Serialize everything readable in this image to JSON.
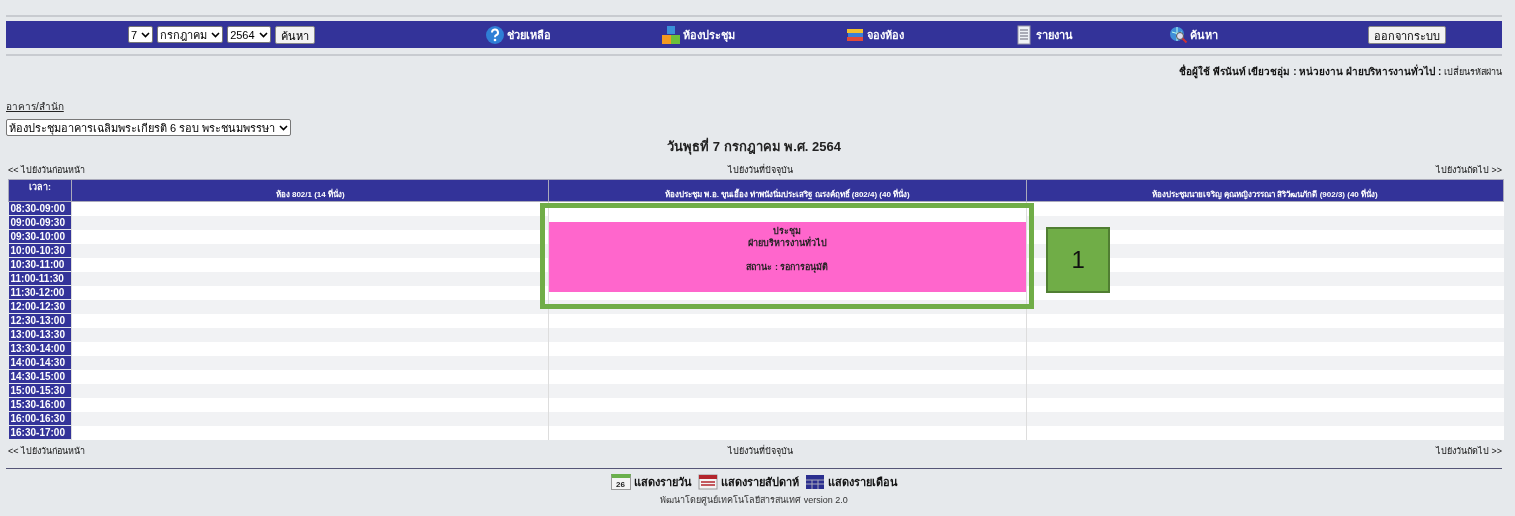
{
  "nav_bar": {
    "day_select": "7",
    "month_select": "กรกฎาคม",
    "year_select": "2564",
    "search_button": "ค้นหา",
    "items": [
      {
        "kind": "help",
        "label": "ช่วยเหลือ"
      },
      {
        "kind": "rooms",
        "label": "ห้องประชุม"
      },
      {
        "kind": "booking",
        "label": "จองห้อง"
      },
      {
        "kind": "report",
        "label": "รายงาน"
      },
      {
        "kind": "search",
        "label": "ค้นหา"
      }
    ],
    "logout_button": "ออกจากระบบ"
  },
  "user_info": {
    "text": "ชื่อผู้ใช้ พีรนันท์ เขียวชอุ่ม : หน่วยงาน ฝ่ายบริหารงานทั่วไป :",
    "link": "เปลี่ยนรหัสผ่าน"
  },
  "building": {
    "label": "อาคาร/สำนัก",
    "select": "ห้องประชุมอาคารเฉลิมพระเกียรติ 6 รอบ พระชนมพรรษา"
  },
  "date_title": "วันพุธที่ 7 กรกฎาคม พ.ศ. 2564",
  "top_links": {
    "previous": "<< ไปยังวันก่อนหน้า",
    "today": "ไปยังวันที่ปัจจุบัน",
    "next": "ไปยังวันถัดไป >>"
  },
  "schedule": {
    "time_heading": "เวลา:",
    "rooms": [
      "ห้อง 802/1 (14 ที่นั่ง)",
      "ห้องประชุม พ.อ. ขุนเอื้อง ท่าพนังนิ่มประเสริฐ ณรงค์ฤทธิ์ (802/4) (40 ที่นั่ง)",
      "ห้องประชุมนายเจริญ คุณหญิงวรรณา สิริวัฒนภักดี (902/3) (40 ที่นั่ง)"
    ],
    "rows": [
      {
        "time": "08:30-09:00",
        "cells": [
          {
            "kind": "free"
          },
          {
            "kind": "free"
          },
          {
            "kind": "free"
          }
        ]
      },
      {
        "time": "09:00-09:30",
        "cells": [
          {
            "kind": "free"
          },
          {
            "kind": "booking",
            "color": "#ff66cc",
            "title": "ประชุม",
            "unit": "ฝ่ายบริหารงานทั่วไป",
            "status": "สถานะ : รอการอนุมัติ"
          },
          {
            "kind": "free"
          }
        ]
      },
      {
        "time": "09:30-10:00",
        "cells": [
          {
            "kind": "free"
          },
          {
            "kind": "continued"
          },
          {
            "kind": "free"
          }
        ]
      },
      {
        "time": "10:00-10:30",
        "cells": [
          {
            "kind": "free"
          },
          {
            "kind": "continued"
          },
          {
            "kind": "free"
          }
        ]
      },
      {
        "time": "10:30-11:00",
        "cells": [
          {
            "kind": "free"
          },
          {
            "kind": "continued"
          },
          {
            "kind": "free"
          }
        ]
      },
      {
        "time": "11:00-11:30",
        "cells": [
          {
            "kind": "free"
          },
          {
            "kind": "continued"
          },
          {
            "kind": "free"
          }
        ]
      },
      {
        "time": "11:30-12:00",
        "cells": [
          {
            "kind": "free"
          },
          {
            "kind": "continued"
          },
          {
            "kind": "free"
          }
        ]
      },
      {
        "time": "12:00-12:30",
        "cells": [
          {
            "kind": "free"
          },
          {
            "kind": "free"
          },
          {
            "kind": "free"
          }
        ]
      },
      {
        "time": "12:30-13:00",
        "cells": [
          {
            "kind": "free"
          },
          {
            "kind": "free"
          },
          {
            "kind": "free"
          }
        ]
      },
      {
        "time": "13:00-13:30",
        "cells": [
          {
            "kind": "free"
          },
          {
            "kind": "free"
          },
          {
            "kind": "free"
          }
        ]
      },
      {
        "time": "13:30-14:00",
        "cells": [
          {
            "kind": "free"
          },
          {
            "kind": "free"
          },
          {
            "kind": "free"
          }
        ]
      },
      {
        "time": "14:00-14:30",
        "cells": [
          {
            "kind": "free"
          },
          {
            "kind": "free"
          },
          {
            "kind": "free"
          }
        ]
      },
      {
        "time": "14:30-15:00",
        "cells": [
          {
            "kind": "free"
          },
          {
            "kind": "free"
          },
          {
            "kind": "free"
          }
        ]
      },
      {
        "time": "15:00-15:30",
        "cells": [
          {
            "kind": "free"
          },
          {
            "kind": "free"
          },
          {
            "kind": "free"
          }
        ]
      },
      {
        "time": "15:30-16:00",
        "cells": [
          {
            "kind": "free"
          },
          {
            "kind": "free"
          },
          {
            "kind": "free"
          }
        ]
      },
      {
        "time": "16:00-16:30",
        "cells": [
          {
            "kind": "free"
          },
          {
            "kind": "free"
          },
          {
            "kind": "free"
          }
        ]
      },
      {
        "time": "16:30-17:00",
        "cells": [
          {
            "kind": "free"
          },
          {
            "kind": "free"
          },
          {
            "kind": "free"
          }
        ]
      }
    ]
  },
  "bottom_links": {
    "previous": "<< ไปยังวันก่อนหน้า",
    "today": "ไปยังวันที่ปัจจุบัน",
    "next": "ไปยังวันถัดไป >>"
  },
  "view_links": [
    {
      "kind": "day",
      "icon_text": "26",
      "label": "แสดงรายวัน"
    },
    {
      "kind": "week",
      "label": "แสดงรายสัปดาห์"
    },
    {
      "kind": "month",
      "label": "แสดงรายเดือน"
    }
  ],
  "credit": "พัฒนาโดยศูนย์เทคโนโลยีสารสนเทศ version 2.0",
  "annotation": {
    "number": "1"
  }
}
